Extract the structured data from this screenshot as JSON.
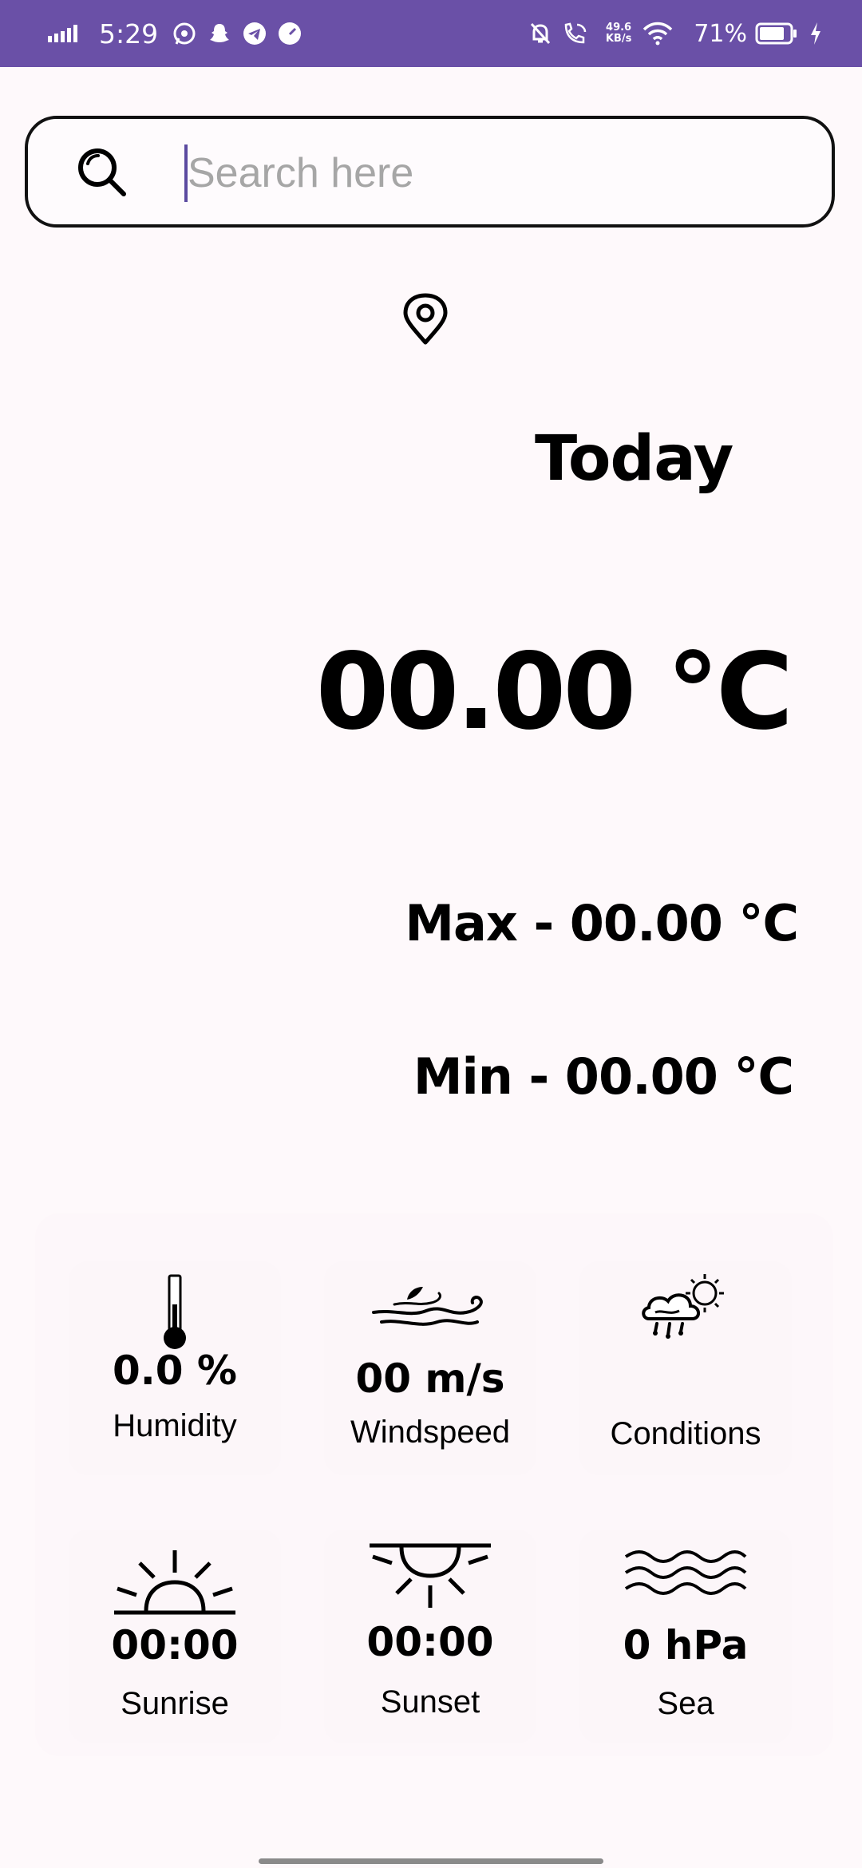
{
  "status_bar": {
    "time": "5:29",
    "net_speed_value": "49.6",
    "net_speed_unit": "KB/s",
    "battery": "71%",
    "color": "#6a50a7"
  },
  "search": {
    "placeholder": "Search here"
  },
  "weather": {
    "day_label": "Today",
    "temperature": "00.00 °C",
    "max": "Max - 00.00 °C",
    "min": "Min - 00.00 °C"
  },
  "stats": [
    {
      "icon": "thermometer-icon",
      "value": "0.0 %",
      "label": "Humidity"
    },
    {
      "icon": "wind-icon",
      "value": "00 m/s",
      "label": "Windspeed"
    },
    {
      "icon": "cloud-sun-rain-icon",
      "value": "",
      "label": "Conditions"
    },
    {
      "icon": "sunrise-icon",
      "value": "00:00",
      "label": "Sunrise"
    },
    {
      "icon": "sunset-icon",
      "value": "00:00",
      "label": "Sunset"
    },
    {
      "icon": "waves-icon",
      "value": "0 hPa",
      "label": "Sea"
    }
  ]
}
